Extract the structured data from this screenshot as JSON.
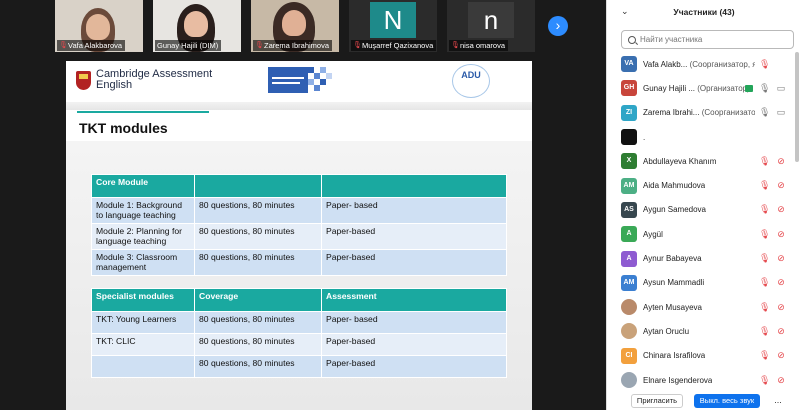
{
  "thumbnails": [
    {
      "name": "Vafa Alakbarova",
      "muted": true
    },
    {
      "name": "Gunay Hajili (DIM)",
      "muted": false
    },
    {
      "name": "Zarema Ibrahimova",
      "muted": true
    },
    {
      "name": "Muşarref Qazixanova",
      "letter": "N",
      "muted": true
    },
    {
      "name": "nisa omarova",
      "letter": "n",
      "muted": true
    }
  ],
  "nav": {
    "next_icon": "›"
  },
  "slide": {
    "logo_text_line1": "Cambridge Assessment",
    "logo_text_line2": "English",
    "adu_logo": "ADU",
    "title": "TKT  modules",
    "table1": {
      "header": [
        "Core Module",
        "",
        ""
      ],
      "rows": [
        [
          "Module 1: Background to language teaching",
          "80 questions, 80 minutes",
          "Paper- based"
        ],
        [
          "Module 2: Planning for language teaching",
          "80 questions, 80 minutes",
          "Paper-based"
        ],
        [
          "Module 3: Classroom management",
          "80 questions, 80 minutes",
          "Paper-based"
        ]
      ]
    },
    "table2": {
      "header": [
        "Specialist modules",
        "Coverage",
        "Assessment"
      ],
      "rows": [
        [
          "TKT: Young Learners",
          "80 questions, 80 minutes",
          "Paper- based"
        ],
        [
          "TKT: CLIC",
          "80 questions, 80 minutes",
          "Paper-based"
        ],
        [
          "",
          "80 questions, 80 minutes",
          "Paper-based"
        ]
      ]
    }
  },
  "panel": {
    "collapse_icon": "⌄",
    "title": "Участники (43)",
    "search_placeholder": "Найти участника",
    "participants": [
      {
        "initials": "VA",
        "color": "#3a6fb0",
        "name": "Vafa Alakb...",
        "role": "(Соорганизатор, я)",
        "mic": "muted",
        "cam": "",
        "icons": "mic-only"
      },
      {
        "initials": "GH",
        "color": "#c8453b",
        "name": "Gunay Hajili ...",
        "role": "(Организатор)",
        "mic": "on",
        "cam": "",
        "icons": "host"
      },
      {
        "initials": "ZI",
        "color": "#2fa6c7",
        "name": "Zarema Ibrahi...",
        "role": "(Соорганизатор)",
        "mic": "on",
        "cam": "",
        "icons": "mic-cam"
      },
      {
        "initials": "",
        "color": "#111111",
        "name": ".",
        "role": "",
        "mic": "",
        "cam": "",
        "icons": "none"
      },
      {
        "initials": "X",
        "color": "#2e7d32",
        "name": "Abdullayeva Khanım",
        "role": "",
        "mic": "muted",
        "cam": "off"
      },
      {
        "initials": "AM",
        "color": "#4caf85",
        "name": "Aida Mahmudova",
        "role": "",
        "mic": "muted",
        "cam": "off"
      },
      {
        "initials": "AS",
        "color": "#37474f",
        "name": "Aygun Samedova",
        "role": "",
        "mic": "muted",
        "cam": "off"
      },
      {
        "initials": "A",
        "color": "#3aa957",
        "name": "Aygül",
        "role": "",
        "mic": "muted",
        "cam": "off"
      },
      {
        "initials": "A",
        "color": "#8e5bd1",
        "name": "Aynur Babayeva",
        "role": "",
        "mic": "muted",
        "cam": "off"
      },
      {
        "initials": "AM",
        "color": "#3b7fd1",
        "name": "Aysun Mammadli",
        "role": "",
        "mic": "muted",
        "cam": "off"
      },
      {
        "initials": "",
        "color": "#b98a6a",
        "name": "Ayten Musayeva",
        "role": "",
        "mic": "muted",
        "cam": "off",
        "photo": true
      },
      {
        "initials": "",
        "color": "#c9a27a",
        "name": "Aytan Oruclu",
        "role": "",
        "mic": "muted",
        "cam": "off",
        "photo": true
      },
      {
        "initials": "CI",
        "color": "#f2a03d",
        "name": "Chinara Israfilova",
        "role": "",
        "mic": "muted",
        "cam": "off"
      },
      {
        "initials": "",
        "color": "#9aa6b2",
        "name": "Elnare Isgenderova",
        "role": "",
        "mic": "muted",
        "cam": "off",
        "photo": true
      }
    ],
    "invite_label": "Пригласить",
    "mute_all_label": "Выкл. весь звук",
    "more_label": "..."
  }
}
